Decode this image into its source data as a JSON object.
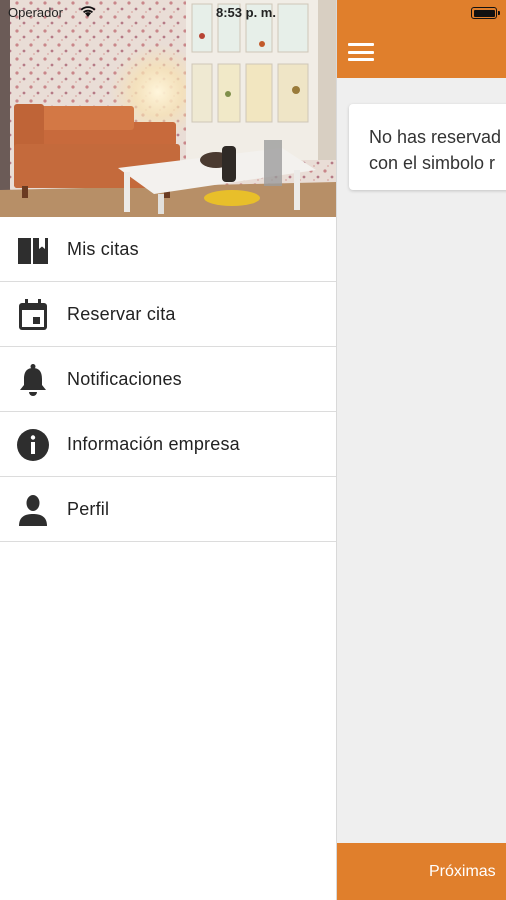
{
  "status_bar": {
    "carrier": "Operador",
    "time": "8:53 p. m."
  },
  "drawer": {
    "items": [
      {
        "label": "Mis citas",
        "icon": "book-icon"
      },
      {
        "label": "Reservar cita",
        "icon": "calendar-icon"
      },
      {
        "label": "Notificaciones",
        "icon": "bell-icon"
      },
      {
        "label": "Información empresa",
        "icon": "info-icon"
      },
      {
        "label": "Perfil",
        "icon": "person-icon"
      }
    ]
  },
  "main": {
    "empty_message_line1": "No has reservad",
    "empty_message_line2": "con el simbolo r",
    "bottom_tab_label": "Próximas"
  },
  "colors": {
    "accent": "#e07f2c",
    "background": "#efefef",
    "text": "#222222"
  }
}
